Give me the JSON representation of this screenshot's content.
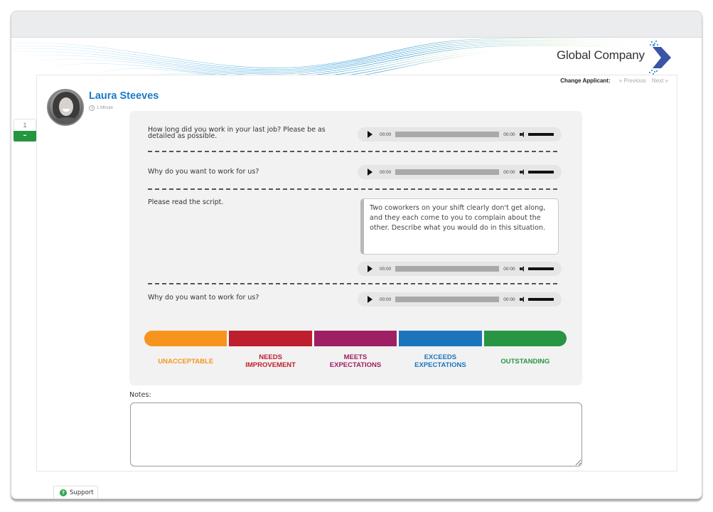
{
  "header": {
    "company_name": "Global Company",
    "change_applicant_label": "Change Applicant:",
    "previous_label": "« Previous",
    "next_label": "Next »"
  },
  "candidate": {
    "name": "Laura Steeves",
    "duration": "1 Minute"
  },
  "pager": {
    "current": "1",
    "collapse_label": "–"
  },
  "questions": [
    {
      "text": "How long did you work in your last job? Please be as detailed as possible.",
      "audio": {
        "current_time": "00:00",
        "duration": "00:00",
        "progress": 0
      }
    },
    {
      "text": "Why do you want to work for us?",
      "audio": {
        "current_time": "00:00",
        "duration": "00:00",
        "progress": 0
      }
    },
    {
      "text": "Please read the script.",
      "script": "Two coworkers on your shift clearly don't get along, and they each come to you to complain about the other. Describe what you would do in this situation.",
      "audio": {
        "current_time": "00:00",
        "duration": "00:00",
        "progress": 0
      }
    },
    {
      "text": "Why do you want to work for us?",
      "audio": {
        "current_time": "00:00",
        "duration": "00:00",
        "progress": 0
      }
    }
  ],
  "rating": {
    "options": [
      {
        "label": "UNACCEPTABLE",
        "color": "#f7941d"
      },
      {
        "label": "NEEDS IMPROVEMENT",
        "color": "#be1e2d"
      },
      {
        "label": "MEETS EXPECTATIONS",
        "color": "#9e1f63"
      },
      {
        "label": "EXCEEDS EXPECTATIONS",
        "color": "#1c75bc"
      },
      {
        "label": "OUTSTANDING",
        "color": "#279544"
      }
    ]
  },
  "notes": {
    "label": "Notes:",
    "value": ""
  },
  "footer": {
    "support_label": "Support",
    "support_icon": "?"
  },
  "colors": {
    "accent_blue": "#1a7bc9",
    "green": "#25963f"
  }
}
